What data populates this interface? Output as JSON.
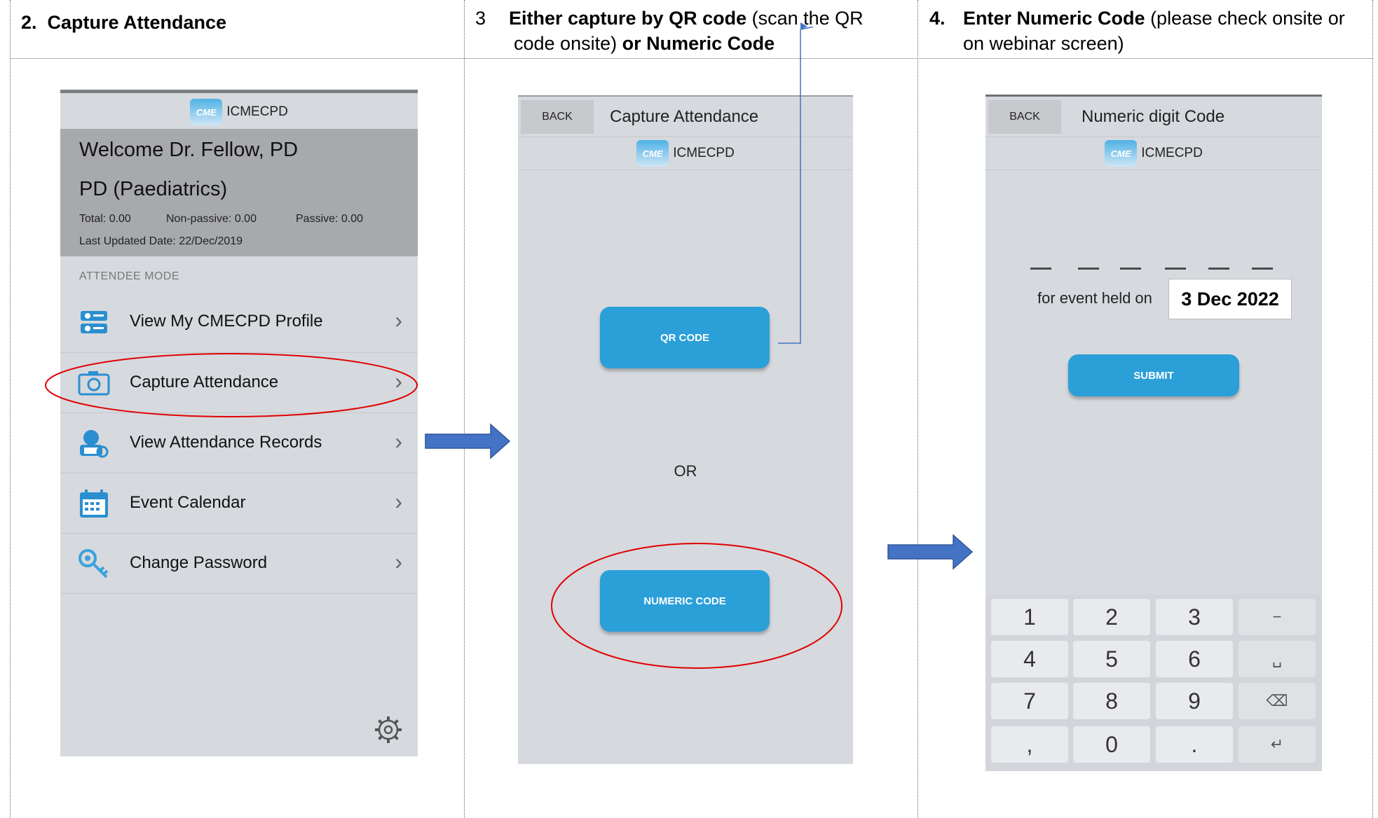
{
  "columns": [
    {
      "num": "2.",
      "title_bold": "Capture Attendance",
      "title_rest": ""
    },
    {
      "num": "3",
      "line1_bold": "Either capture by QR code",
      "line1_rest": " (scan the QR",
      "line2_rest": "code onsite) ",
      "line2_bold": "or Numeric Code"
    },
    {
      "num": "4.",
      "line1_bold": "Enter Numeric Code",
      "line1_rest": " (please check onsite or",
      "line2_rest": "on webinar screen)"
    }
  ],
  "app": {
    "brand": "ICMECPD",
    "logo_text": "CME"
  },
  "screen1": {
    "welcome": "Welcome Dr. Fellow, PD",
    "specialty": "PD (Paediatrics)",
    "total": "Total: 0.00",
    "non_passive": "Non-passive: 0.00",
    "passive": "Passive: 0.00",
    "last_updated": "Last Updated Date: 22/Dec/2019",
    "mode_label": "ATTENDEE MODE",
    "menu": [
      {
        "label": "View My CMECPD Profile",
        "icon": "profile-icon"
      },
      {
        "label": "Capture Attendance",
        "icon": "camera-icon"
      },
      {
        "label": "View Attendance Records",
        "icon": "records-icon"
      },
      {
        "label": "Event Calendar",
        "icon": "calendar-icon"
      },
      {
        "label": "Change Password",
        "icon": "key-icon"
      }
    ]
  },
  "screen2": {
    "back": "BACK",
    "title": "Capture Attendance",
    "qr_button": "QR CODE",
    "or_text": "OR",
    "numeric_button": "NUMERIC CODE"
  },
  "screen3": {
    "back": "BACK",
    "title": "Numeric digit Code",
    "event_text": "for event held on",
    "event_date": "3 Dec 2022",
    "submit": "SUBMIT",
    "keys": [
      [
        "1",
        "2",
        "3",
        "−"
      ],
      [
        "4",
        "5",
        "6",
        "␣"
      ],
      [
        "7",
        "8",
        "9",
        "⌫"
      ],
      [
        ",",
        "0",
        ".",
        "↵"
      ]
    ]
  },
  "colors": {
    "accent": "#2b9fd8",
    "arrow": "#4472c4",
    "highlight": "#e00000"
  }
}
